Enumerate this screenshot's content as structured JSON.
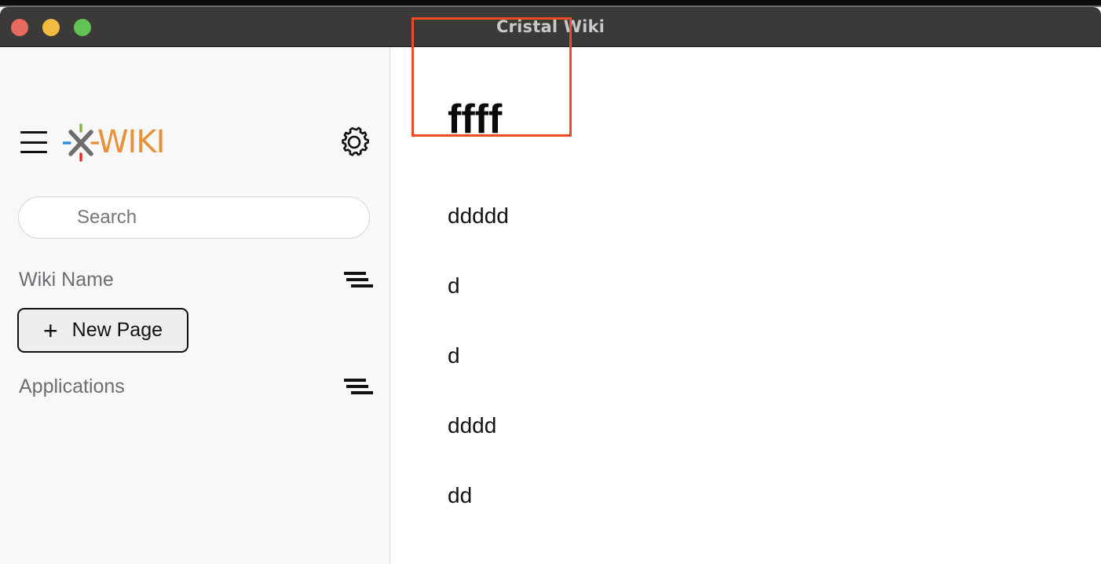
{
  "window": {
    "title": "Cristal Wiki",
    "controls": [
      {
        "name": "close",
        "color": "#e8695e"
      },
      {
        "name": "minimize",
        "color": "#f0bb41"
      },
      {
        "name": "zoom",
        "color": "#62c354"
      }
    ]
  },
  "sidebar": {
    "menu_icon": "hamburger-icon",
    "brand": {
      "mark": "xwiki-logo-mark",
      "text": "WIKI",
      "color": "#e8913a"
    },
    "settings_icon": "gear-icon",
    "search": {
      "placeholder": "Search",
      "value": ""
    },
    "sections": [
      {
        "title": "Wiki Name",
        "toggle_icon": "collapse-lines-icon"
      },
      {
        "title": "Applications",
        "toggle_icon": "collapse-lines-icon"
      }
    ],
    "new_page_button": {
      "plus": "+",
      "label": "New Page"
    }
  },
  "content": {
    "page_title": "ffff",
    "items": [
      "ddddd",
      "d",
      "d",
      "dddd",
      "dd"
    ]
  },
  "annotation": {
    "shape": "rectangle-highlight",
    "color": "#ef4a28"
  }
}
